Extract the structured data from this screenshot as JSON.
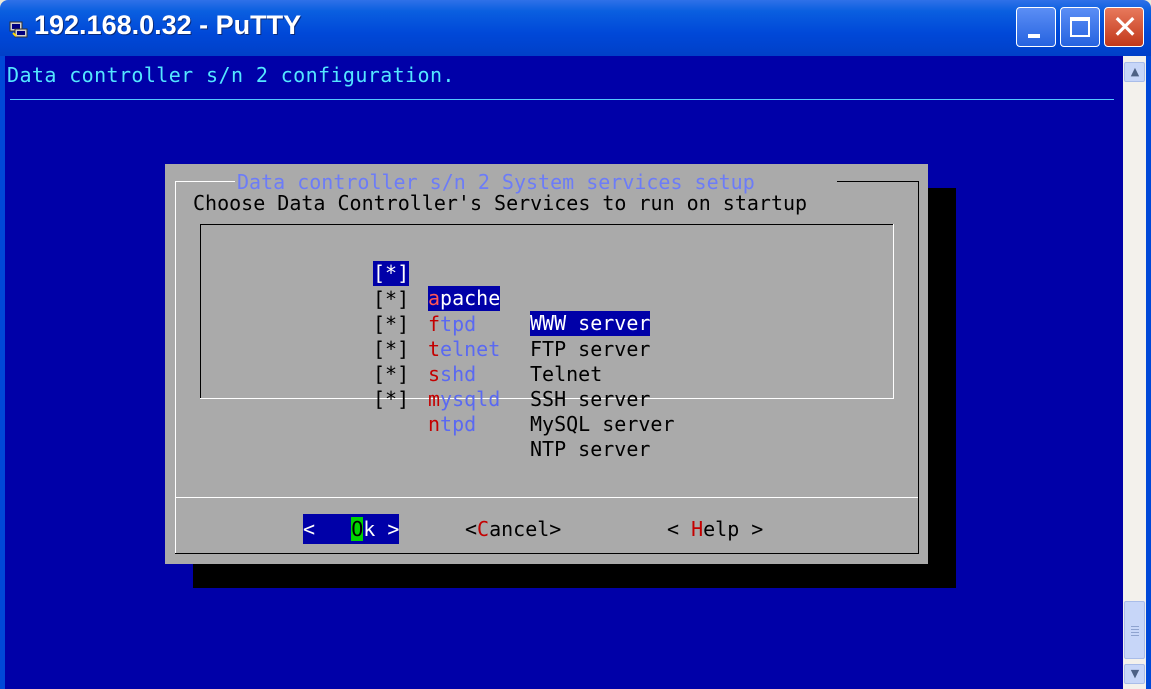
{
  "window": {
    "title": "192.168.0.32 - PuTTY"
  },
  "terminal": {
    "header": "Data controller s/n 2 configuration.",
    "bg_color": "#0000a8"
  },
  "dialog": {
    "title": "Data controller s/n 2 System services setup",
    "subtitle": "Choose Data Controller's Services to run on startup",
    "items": [
      {
        "check": "[*]",
        "tag_hot": "a",
        "tag_rest": "pache",
        "desc": "WWW server"
      },
      {
        "check": "[*]",
        "tag_hot": "f",
        "tag_rest": "tpd",
        "desc": "FTP server"
      },
      {
        "check": "[*]",
        "tag_hot": "t",
        "tag_rest": "elnet",
        "desc": "Telnet"
      },
      {
        "check": "[*]",
        "tag_hot": "s",
        "tag_rest": "shd",
        "desc": "SSH server"
      },
      {
        "check": "[*]",
        "tag_hot": "m",
        "tag_rest": "ysqld",
        "desc": "MySQL server"
      },
      {
        "check": "[*]",
        "tag_hot": "n",
        "tag_rest": "tpd",
        "desc": "NTP server"
      }
    ],
    "buttons": {
      "ok": {
        "pre": "< ",
        "hot": "O",
        "post": "k >"
      },
      "cancel": {
        "pre": "<",
        "hot": "C",
        "post": "ancel>"
      },
      "help": {
        "pre": "< ",
        "hot": "H",
        "post": "elp >"
      }
    }
  }
}
